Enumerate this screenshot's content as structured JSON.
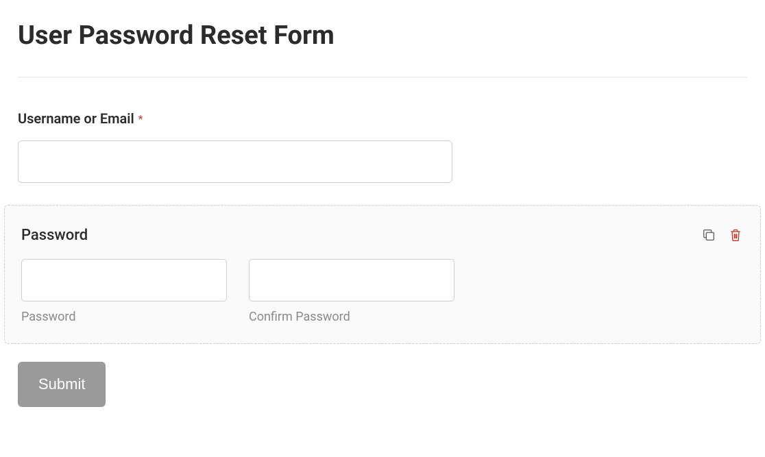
{
  "title": "User Password Reset Form",
  "fields": {
    "username": {
      "label": "Username or Email",
      "required": true,
      "value": "",
      "placeholder": ""
    },
    "password_block": {
      "label": "Password",
      "password": {
        "value": "",
        "sublabel": "Password"
      },
      "confirm": {
        "value": "",
        "sublabel": "Confirm Password"
      }
    }
  },
  "submit_label": "Submit",
  "icons": {
    "duplicate": "duplicate-icon",
    "delete": "trash-icon"
  }
}
